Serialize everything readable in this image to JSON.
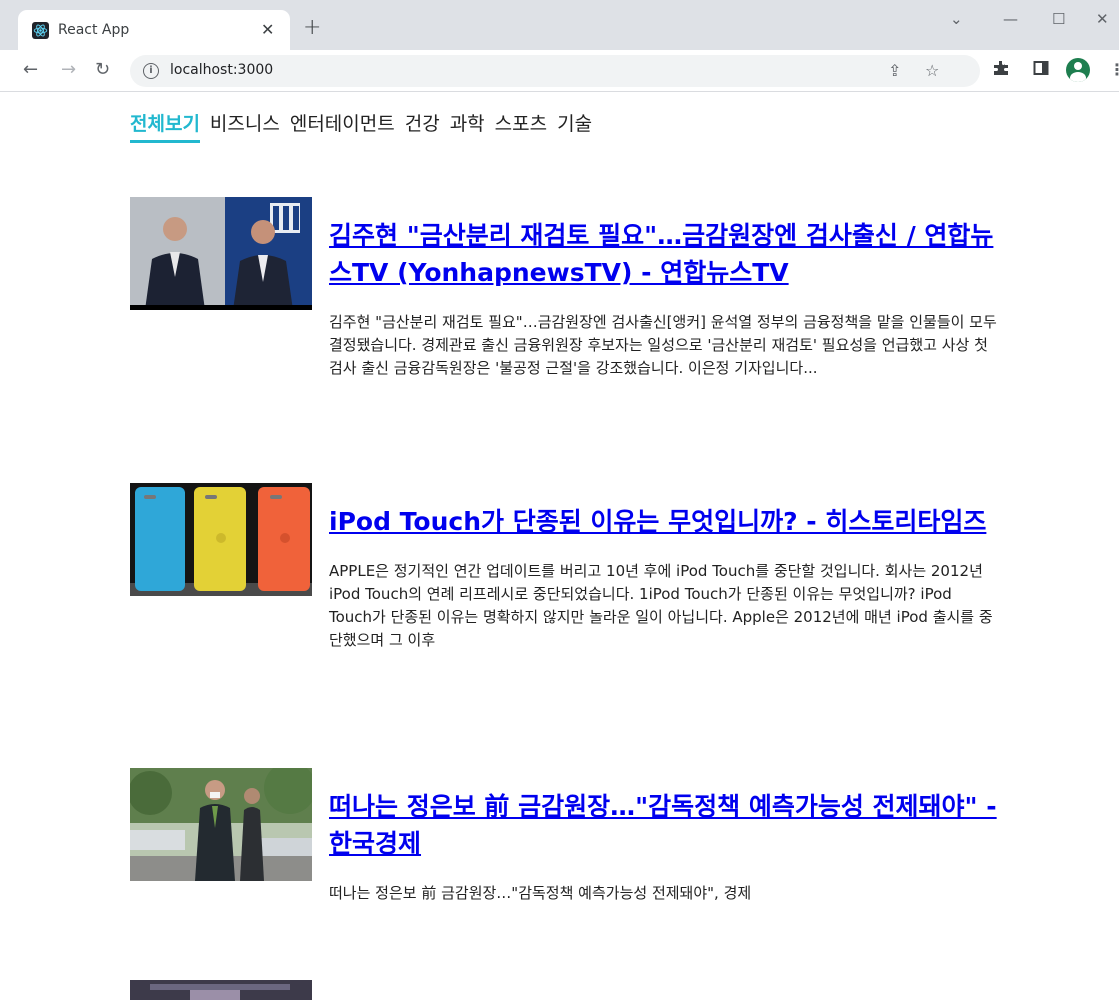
{
  "browser": {
    "tab_title": "React App",
    "tab_close": "✕",
    "new_tab": "+",
    "url": "localhost:3000",
    "window_controls": {
      "dropdown": "⌄",
      "minimize": "—",
      "maximize": "☐",
      "close": "✕"
    },
    "icons": [
      "back-icon",
      "forward-icon",
      "reload-icon",
      "info-icon",
      "share-icon",
      "star-icon",
      "extensions-icon",
      "sidepanel-icon",
      "profile-icon",
      "menu-icon"
    ],
    "accent": "#22b8cf"
  },
  "categories": [
    {
      "label": "전체보기",
      "active": true
    },
    {
      "label": "비즈니스",
      "active": false
    },
    {
      "label": "엔터테이먼트",
      "active": false
    },
    {
      "label": "건강",
      "active": false
    },
    {
      "label": "과학",
      "active": false
    },
    {
      "label": "스포츠",
      "active": false
    },
    {
      "label": "기술",
      "active": false
    }
  ],
  "articles": [
    {
      "title": "김주현 \"금산분리 재검토 필요\"…금감원장엔 검사출신 / 연합뉴스TV (YonhapnewsTV) - 연합뉴스TV",
      "description": "김주현 \"금산분리 재검토 필요\"…금감원장엔 검사출신[앵커] 윤석열 정부의 금융정책을 맡을 인물들이 모두 결정됐습니다. 경제관료 출신 금융위원장 후보자는 일성으로 '금산분리 재검토' 필요성을 언급했고 사상 첫 검사 출신 금융감독원장은 '불공정 근절'을 강조했습니다. 이은정 기자입니다..."
    },
    {
      "title": "iPod Touch가 단종된 이유는 무엇입니까? - 히스토리타임즈",
      "description": "APPLE은 정기적인 연간 업데이트를 버리고 10년 후에 iPod Touch를 중단할 것입니다. 회사는 2012년 iPod Touch의 연례 리프레시로 중단되었습니다. 1iPod Touch가 단종된 이유는 무엇입니까? iPod Touch가 단종된 이유는 명확하지 않지만 놀라운 일이 아닙니다. Apple은 2012년에 매년 iPod 출시를 중단했으며 그 이후"
    },
    {
      "title": "떠나는 정은보 前 금감원장…\"감독정책 예측가능성 전제돼야\" - 한국경제",
      "description": "떠나는 정은보 前 금감원장…\"감독정책 예측가능성 전제돼야\", 경제"
    }
  ]
}
